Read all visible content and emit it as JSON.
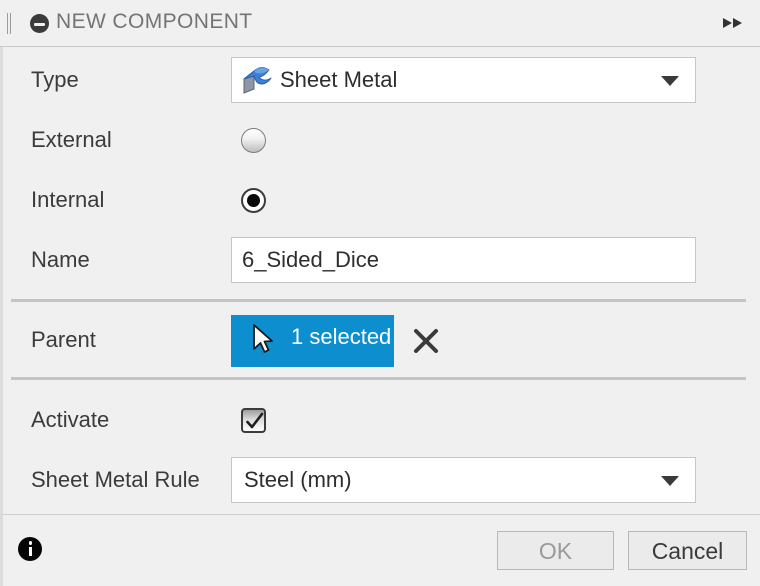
{
  "window": {
    "title": "NEW COMPONENT",
    "grip_icon": "drag-grip-icon",
    "collapse_icon": "minus-circle-icon",
    "expand_icon": "fast-forward-icon"
  },
  "form": {
    "type": {
      "label": "Type",
      "value": "Sheet Metal",
      "icon": "sheet-metal-icon",
      "caret_icon": "chevron-down-icon"
    },
    "external": {
      "label": "External",
      "selected": false
    },
    "internal": {
      "label": "Internal",
      "selected": true
    },
    "name": {
      "label": "Name",
      "value": "6_Sided_Dice"
    },
    "parent": {
      "label": "Parent",
      "button_label": "1 selected",
      "cursor_icon": "mouse-cursor-icon",
      "clear_icon": "close-x-icon",
      "accent_color": "#0d8ecf"
    },
    "activate": {
      "label": "Activate",
      "checked": true,
      "check_icon": "checkmark-icon"
    },
    "sheet_metal_rule": {
      "label": "Sheet Metal Rule",
      "value": "Steel (mm)",
      "caret_icon": "chevron-down-icon"
    }
  },
  "footer": {
    "info_icon": "info-circle-icon",
    "ok_label": "OK",
    "cancel_label": "Cancel"
  }
}
